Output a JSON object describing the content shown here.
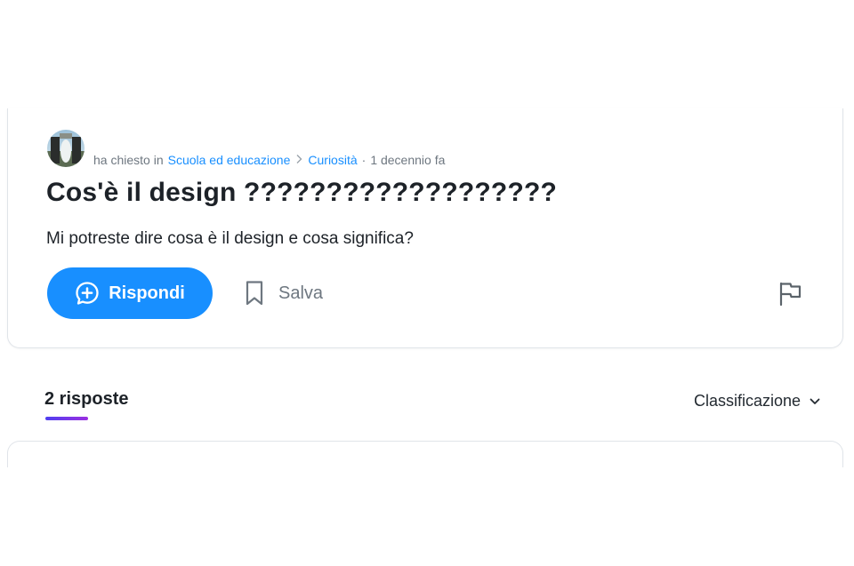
{
  "question": {
    "meta": {
      "asked_text": "ha chiesto in",
      "category": "Scuola ed educazione",
      "subcategory": "Curiosità",
      "separator": "·",
      "time_ago": "1 decennio fa"
    },
    "title": "Cos'è il design ???????????????????",
    "body": "Mi potreste dire cosa è il design e cosa significa?",
    "actions": {
      "answer_label": "Rispondi",
      "save_label": "Salva"
    }
  },
  "answers": {
    "count_label": "2 risposte",
    "sort_label": "Classificazione"
  },
  "colors": {
    "accent": "#188fff",
    "title_text": "#1d2228",
    "muted_text": "#6e7780",
    "underline_gradient": [
      "#4f3ff0",
      "#9b2fe0"
    ]
  },
  "icons": {
    "answer": "plus-bubble-icon",
    "save": "bookmark-icon",
    "report": "flag-icon",
    "breadcrumb_separator": "chevron-right-icon",
    "sort": "chevron-down-icon"
  }
}
